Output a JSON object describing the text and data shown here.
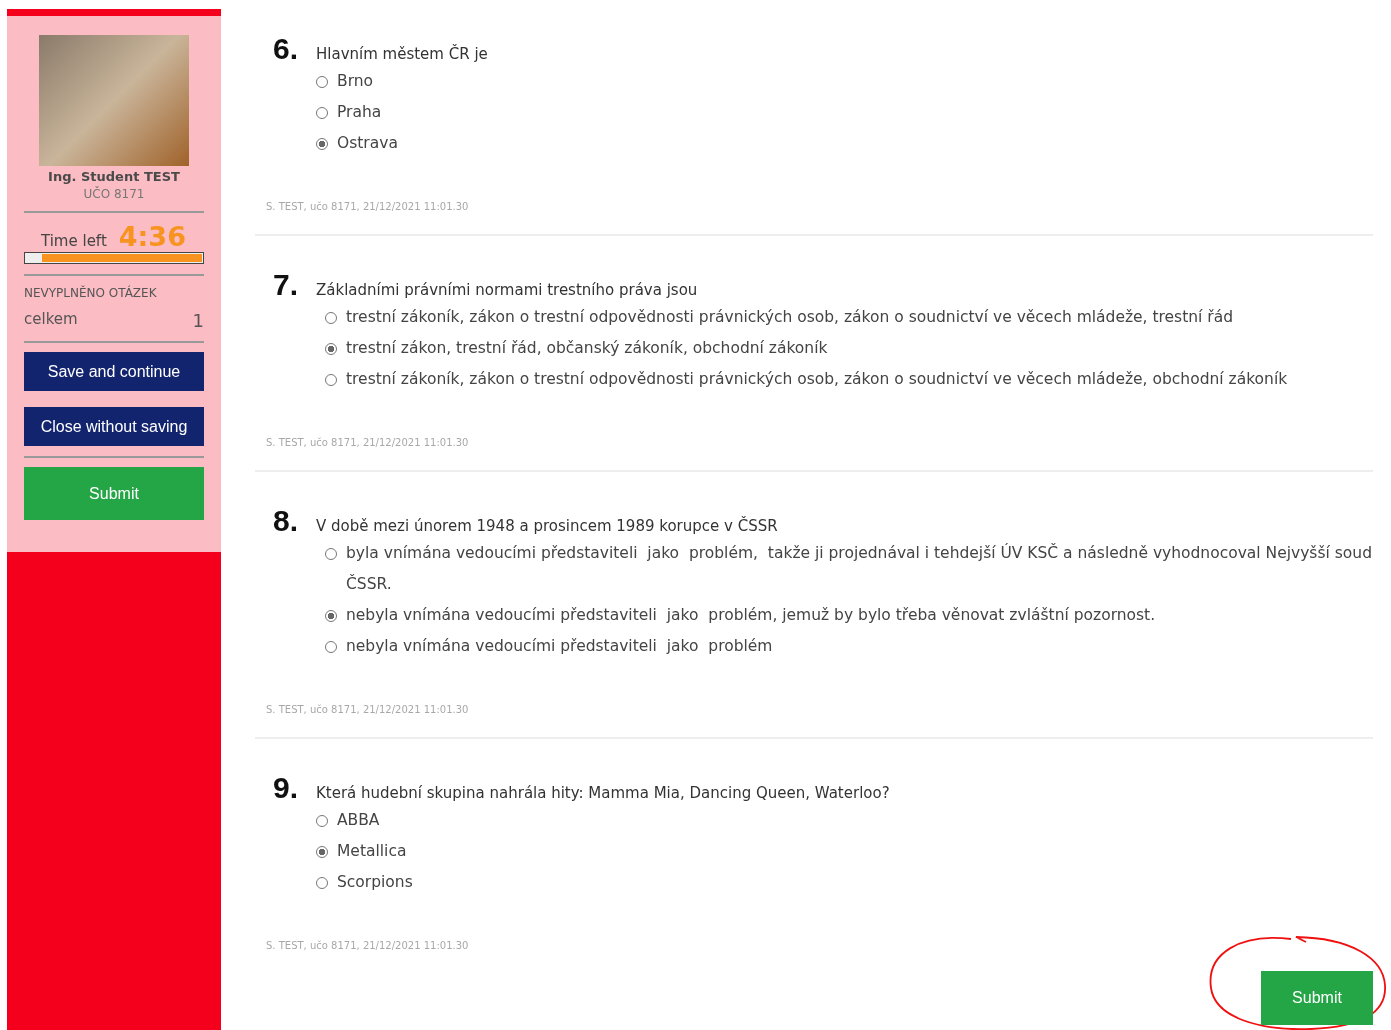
{
  "sidebar": {
    "user_name": "Ing. Student TEST",
    "uco": "UČO 8171",
    "timer": {
      "label": "Time left",
      "value": "4:36",
      "level": 0.91
    },
    "unanswered": {
      "heading": "NEVYPLNĚNO OTÁZEK",
      "label": "celkem",
      "count": "1"
    },
    "buttons": [
      {
        "label": "Save and continue",
        "kind": "primary"
      },
      {
        "label": "Close without saving",
        "kind": "primary"
      },
      {
        "label": "Submit",
        "kind": "submit"
      }
    ]
  },
  "questions": [
    {
      "number": "6.",
      "text": "Hlavním městem ČR je",
      "kind": "list",
      "footer": "S. TEST, učo 8171, 21/12/2021 11:01.30",
      "options": [
        {
          "label": "Brno",
          "selected": false
        },
        {
          "label": "Praha",
          "selected": false
        },
        {
          "label": "Ostrava",
          "selected": true
        }
      ]
    },
    {
      "number": "7.",
      "text": "Základními právními normami trestního práva jsou",
      "kind": "inline",
      "footer": "S. TEST, učo 8171, 21/12/2021 11:01.30",
      "options": [
        {
          "label": "trestní zákoník, zákon o trestní odpovědnosti právnických osob, zákon o soudnictví ve věcech mládeže, trestní řád",
          "selected": false
        },
        {
          "label": "trestní zákon, trestní řád, občanský zákoník, obchodní zákoník",
          "selected": true
        },
        {
          "label": "trestní zákoník, zákon o trestní odpovědnosti právnických osob, zákon o soudnictví ve věcech mládeže, obchodní zákoník",
          "selected": false
        }
      ]
    },
    {
      "number": "8.",
      "text": "V době mezi únorem 1948 a prosincem 1989 korupce v ČSSR",
      "kind": "inline",
      "footer": "S. TEST, učo 8171, 21/12/2021 11:01.30",
      "options": [
        {
          "label": "byla vnímána vedoucími představiteli  jako  problém,  takže ji projednával i tehdejší ÚV KSČ a následně vyhodnocoval Nejvyšší soud ČSSR.",
          "selected": false
        },
        {
          "label": "nebyla vnímána vedoucími představiteli  jako  problém, jemuž by bylo třeba věnovat zvláštní pozornost.",
          "selected": true
        },
        {
          "label": "nebyla vnímána vedoucími představiteli  jako  problém",
          "selected": false
        }
      ]
    },
    {
      "number": "9.",
      "text": "Která hudební skupina nahrála hity: Mamma Mia, Dancing Queen, Waterloo?",
      "kind": "list",
      "footer": "S. TEST, učo 8171, 21/12/2021 11:01.30",
      "options": [
        {
          "label": "ABBA",
          "selected": false
        },
        {
          "label": "Metallica",
          "selected": true
        },
        {
          "label": "Scorpions",
          "selected": false
        }
      ]
    }
  ],
  "submit_button": {
    "label": "Submit",
    "annotated": true
  }
}
